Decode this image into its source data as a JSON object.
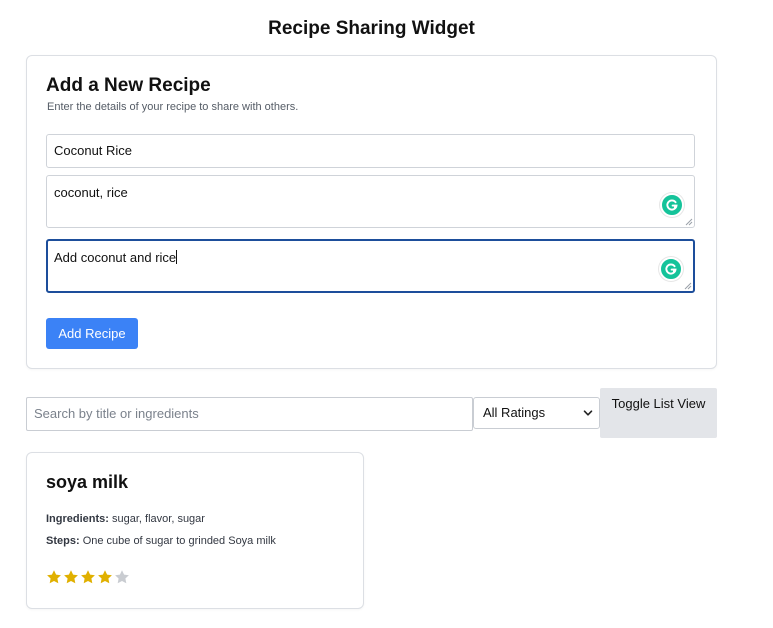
{
  "page": {
    "title": "Recipe Sharing Widget"
  },
  "form": {
    "heading": "Add a New Recipe",
    "subtitle": "Enter the details of your recipe to share with others.",
    "title_value": "Coconut Rice",
    "ingredients_value": "coconut, rice",
    "steps_value": "Add coconut and rice",
    "submit_label": "Add Recipe"
  },
  "toolbar": {
    "search_placeholder": "Search by title or ingredients",
    "rating_filter_selected": "All Ratings",
    "toggle_label": "Toggle List View"
  },
  "recipes": [
    {
      "title": "soya milk",
      "ingredients_label": "Ingredients:",
      "ingredients": "sugar, flavor, sugar",
      "steps_label": "Steps:",
      "steps": "One cube of sugar to grinded Soya milk",
      "rating": 4,
      "rating_max": 5
    }
  ],
  "colors": {
    "accent": "#3b82f6",
    "focus_border": "#1d4e9b",
    "star_filled": "#e0b000",
    "star_empty": "#c9ccd1",
    "grammar_badge": "#15c39a"
  },
  "icons": {
    "grammar_assistant": "grammar-assistant-icon",
    "select_arrow": "chevron-down-icon",
    "star": "star-icon"
  }
}
